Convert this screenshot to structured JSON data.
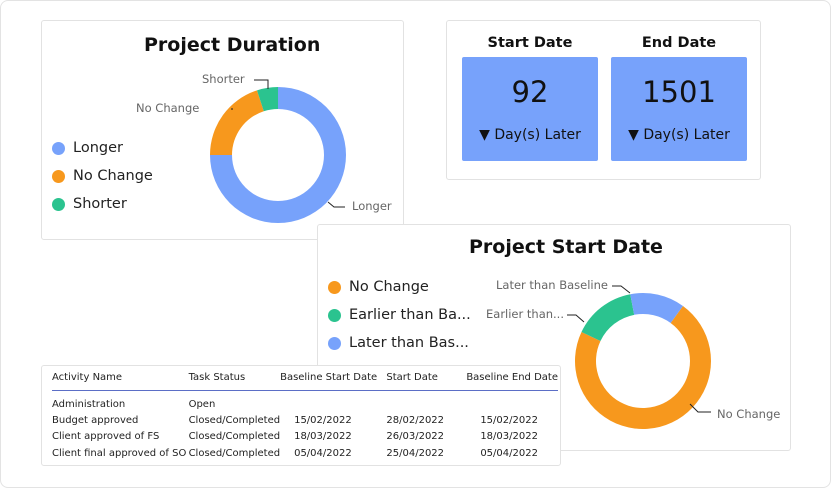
{
  "project_duration": {
    "title": "Project Duration",
    "legend": [
      {
        "label": "Longer",
        "color": "#77a2fb"
      },
      {
        "label": "No Change",
        "color": "#f7981d"
      },
      {
        "label": "Shorter",
        "color": "#2bc38f"
      }
    ],
    "slice_labels": {
      "shorter": "Shorter",
      "no_change": "No Change",
      "longer": "Longer"
    },
    "chart_data": {
      "type": "pie",
      "categories": [
        "Longer",
        "No Change",
        "Shorter"
      ],
      "values": [
        75,
        20,
        5
      ],
      "colors": [
        "#77a2fb",
        "#f7981d",
        "#2bc38f"
      ]
    }
  },
  "dates_kpi": {
    "start": {
      "title": "Start Date",
      "value": "92",
      "subtitle": "▼ Day(s) Later"
    },
    "end": {
      "title": "End Date",
      "value": "1501",
      "subtitle": "▼ Day(s) Later"
    },
    "box_color": "#77a2fb"
  },
  "project_start_date": {
    "title": "Project Start Date",
    "legend": [
      {
        "label": "No Change",
        "color": "#f7981d"
      },
      {
        "label": "Earlier than Ba...",
        "color": "#2bc38f"
      },
      {
        "label": "Later than Bas...",
        "color": "#77a2fb"
      }
    ],
    "slice_labels": {
      "later": "Later than Baseline",
      "earlier": "Earlier than...",
      "no_change": "No Change"
    },
    "chart_data": {
      "type": "pie",
      "categories": [
        "No Change",
        "Earlier than Baseline",
        "Later than Baseline"
      ],
      "values": [
        72,
        15,
        13
      ],
      "colors": [
        "#f7981d",
        "#2bc38f",
        "#77a2fb"
      ]
    }
  },
  "activity_table": {
    "columns": [
      "Activity Name",
      "Task Status",
      "Baseline Start Date",
      "Start Date",
      "Baseline End Date"
    ],
    "rows": [
      {
        "activity": "Administration",
        "status": "Open",
        "baseline_start": "",
        "start": "",
        "baseline_end": ""
      },
      {
        "activity": "Budget approved",
        "status": "Closed/Completed",
        "baseline_start": "15/02/2022",
        "start": "28/02/2022",
        "baseline_end": "15/02/2022"
      },
      {
        "activity": "Client approved of FS",
        "status": "Closed/Completed",
        "baseline_start": "18/03/2022",
        "start": "26/03/2022",
        "baseline_end": "18/03/2022"
      },
      {
        "activity": "Client final approved of SO",
        "status": "Closed/Completed",
        "baseline_start": "05/04/2022",
        "start": "25/04/2022",
        "baseline_end": "05/04/2022"
      }
    ]
  }
}
